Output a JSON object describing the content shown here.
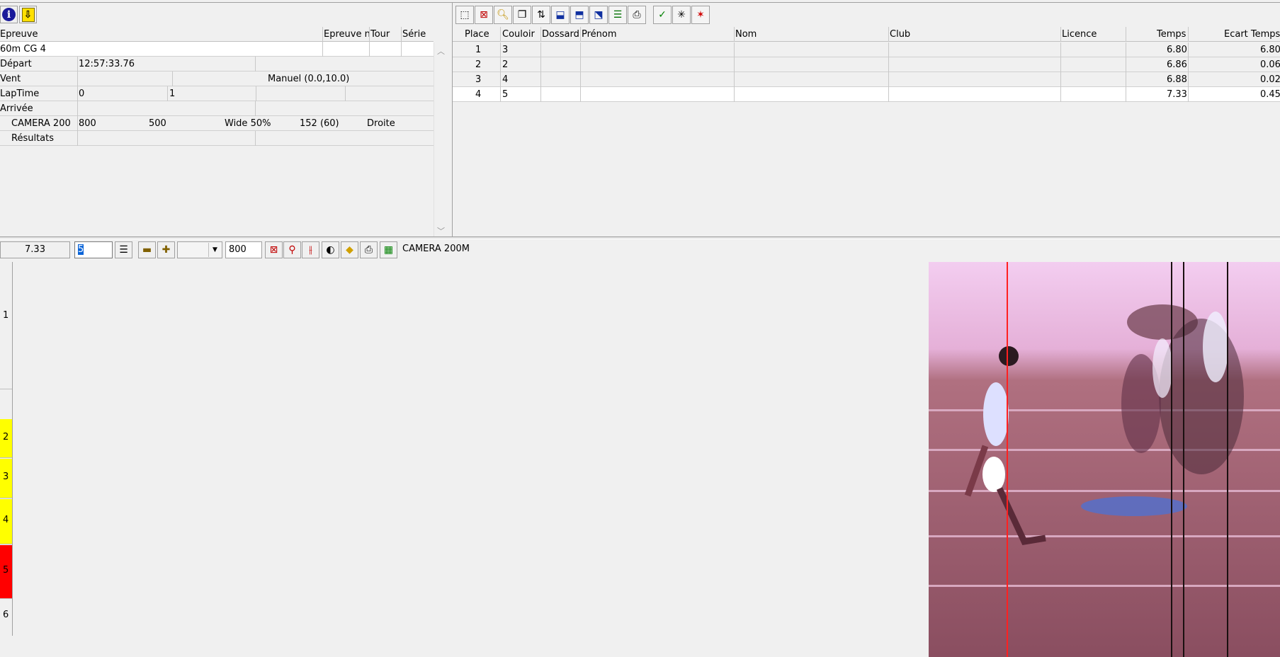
{
  "left_toolbar": {
    "info_icon": "info-icon",
    "down_icon": "down-arrow-icon"
  },
  "event": {
    "headers": {
      "epreuve": "Epreuve",
      "epreuve_n": "Epreuve n",
      "tour": "Tour",
      "serie": "Série"
    },
    "name": "60m CG 4",
    "depart_label": "Départ",
    "depart_time": "12:57:33.76",
    "vent_label": "Vent",
    "vent_value": "Manuel (0.0,10.0)",
    "laptime_label": "LapTime",
    "laptime_a": "0",
    "laptime_b": "1",
    "arrivee_label": "Arrivée",
    "camera_label": "CAMERA 200",
    "camera_v1": "800",
    "camera_v2": "500",
    "camera_v3": "Wide 50%",
    "camera_v4": "152  (60)",
    "camera_v5": "Droite",
    "resultats_label": "Résultats"
  },
  "results": {
    "headers": {
      "place": "Place",
      "couloir": "Couloir",
      "dossard": "Dossard",
      "prenom": "Prénom",
      "nom": "Nom",
      "club": "Club",
      "licence": "Licence",
      "temps": "Temps",
      "ecart": "Ecart Temps"
    },
    "rows": [
      {
        "place": "1",
        "couloir": "3",
        "temps": "6.80",
        "ecart": "6.80"
      },
      {
        "place": "2",
        "couloir": "2",
        "temps": "6.86",
        "ecart": "0.06"
      },
      {
        "place": "3",
        "couloir": "4",
        "temps": "6.88",
        "ecart": "0.02"
      },
      {
        "place": "4",
        "couloir": "5",
        "temps": "7.33",
        "ecart": "0.45"
      }
    ]
  },
  "viewer": {
    "time": "7.33",
    "lane_input": "5",
    "resolution": "800",
    "camera_name": "CAMERA 200M",
    "lanes": [
      {
        "label": "1",
        "color": "#f0f0f0"
      },
      {
        "label": "2",
        "color": "#ffff00"
      },
      {
        "label": "3",
        "color": "#ffff00"
      },
      {
        "label": "4",
        "color": "#ffff00"
      },
      {
        "label": "5",
        "color": "#ff0000"
      },
      {
        "label": "6",
        "color": "#f0f0f0"
      }
    ]
  },
  "colors": {
    "highlight_yellow": "#ffff00",
    "highlight_red": "#ff0000",
    "cursor_line": "#ff0000"
  }
}
